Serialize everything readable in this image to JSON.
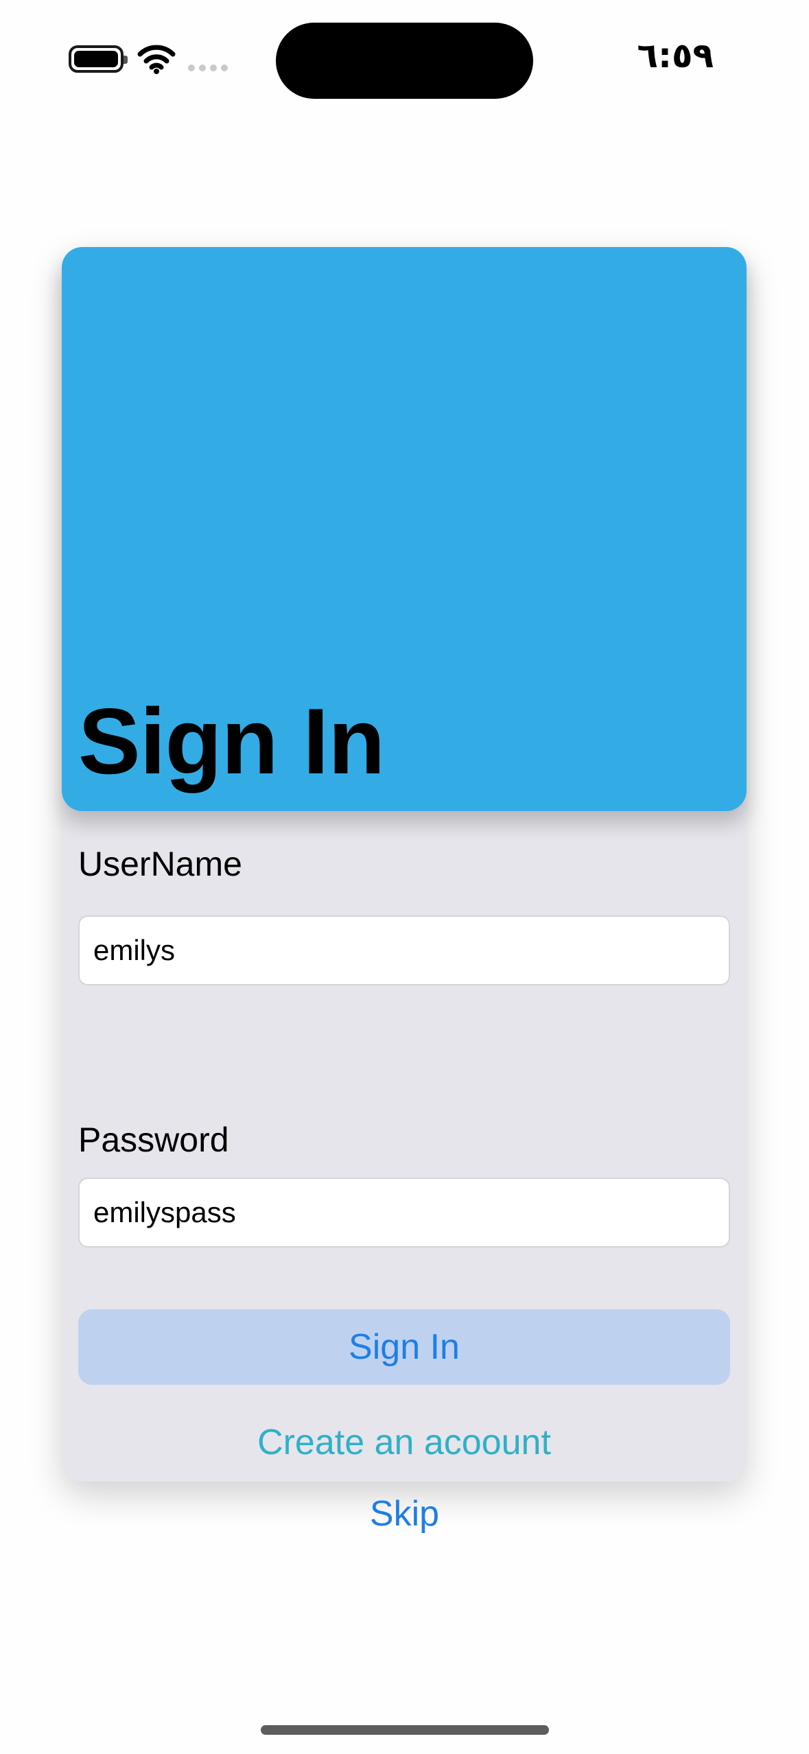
{
  "status_bar": {
    "time": "٦:٥٩",
    "battery_icon": "battery-full-icon",
    "wifi_icon": "wifi-icon",
    "signal_icon": "cellular-no-signal-icon"
  },
  "header": {
    "title": "Sign In",
    "background_color": "#33ace6"
  },
  "form": {
    "username_label": "UserName",
    "username_value": "emilys",
    "password_label": "Password",
    "password_value": "emilyspass",
    "signin_button_label": "Sign In",
    "create_account_label": "Create an acoount"
  },
  "footer": {
    "skip_label": "Skip"
  },
  "colors": {
    "accent": "#1e7ee6",
    "link_teal": "#2fb0c8",
    "card_background": "#e5e5eb",
    "button_background": "#bed1ef"
  }
}
